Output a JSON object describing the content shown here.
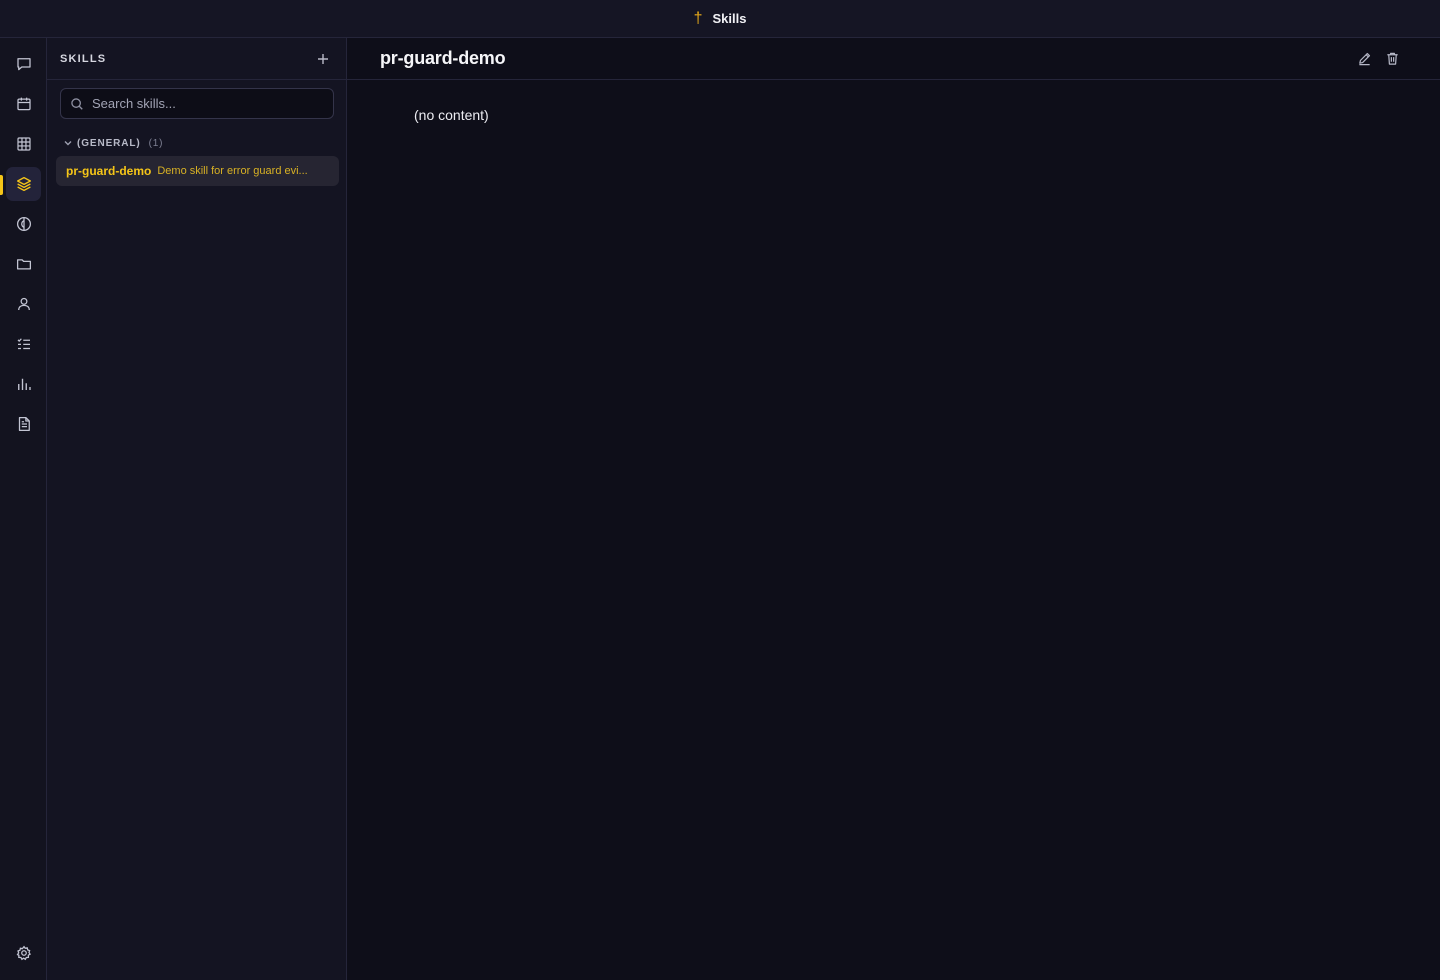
{
  "window": {
    "title": "Skills",
    "app_icon": "dagger-icon",
    "accent": "#f5c518"
  },
  "rail": {
    "items": [
      {
        "name": "chat",
        "icon": "chat-bubble-icon"
      },
      {
        "name": "calendar",
        "icon": "calendar-icon"
      },
      {
        "name": "table",
        "icon": "grid-icon"
      },
      {
        "name": "skills",
        "icon": "layers-icon",
        "active": true
      },
      {
        "name": "brain",
        "icon": "brain-icon"
      },
      {
        "name": "files",
        "icon": "folder-icon"
      },
      {
        "name": "people",
        "icon": "user-icon"
      },
      {
        "name": "tasks",
        "icon": "checklist-icon"
      },
      {
        "name": "analytics",
        "icon": "bar-chart-icon"
      },
      {
        "name": "docs",
        "icon": "document-icon"
      }
    ],
    "settings_icon": "gear-icon"
  },
  "sidebar": {
    "title": "SKILLS",
    "search": {
      "placeholder": "Search skills...",
      "value": ""
    },
    "groups": [
      {
        "name": "(GENERAL)",
        "count": "(1)",
        "expanded": true,
        "items": [
          {
            "name": "pr-guard-demo",
            "description": "Demo skill for error guard evi...",
            "selected": true
          }
        ]
      }
    ]
  },
  "main": {
    "title": "pr-guard-demo",
    "content": "(no content)",
    "actions": [
      "edit-icon",
      "trash-icon"
    ]
  }
}
